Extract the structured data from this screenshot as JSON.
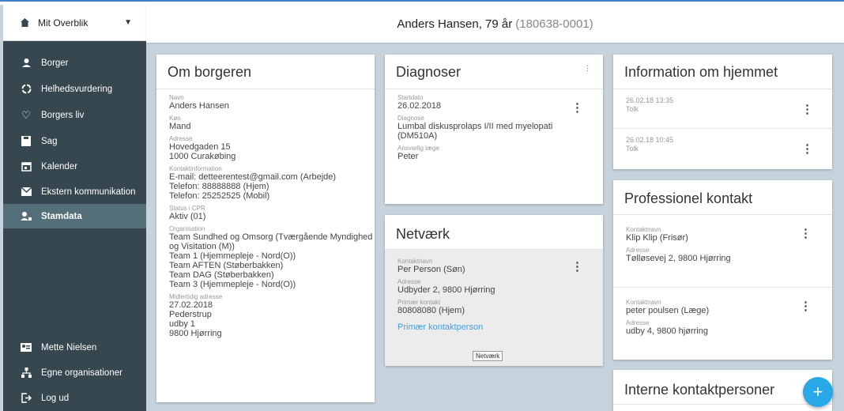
{
  "sidebar": {
    "overview_label": "Mit Overblik",
    "nav": [
      {
        "label": "Borger"
      },
      {
        "label": "Helhedsvurdering"
      },
      {
        "label": "Borgers liv"
      },
      {
        "label": "Sag"
      },
      {
        "label": "Kalender"
      },
      {
        "label": "Ekstern kommunikation"
      },
      {
        "label": "Stamdata"
      }
    ],
    "bottom": [
      {
        "label": "Mette Nielsen"
      },
      {
        "label": "Egne organisationer"
      },
      {
        "label": "Log ud"
      }
    ]
  },
  "header": {
    "name": "Anders Hansen, 79 år",
    "cpr": "(180638-0001)"
  },
  "om": {
    "title": "Om borgeren",
    "navn_label": "Navn",
    "navn": "Anders Hansen",
    "kon_label": "Køn",
    "kon": "Mand",
    "adresse_label": "Adresse",
    "adresse1": "Hovedgaden 15",
    "adresse2": "1000 Curakøbing",
    "kontakt_label": "Kontaktinformation",
    "kontakt1": "E-mail: detteerentest@gmail.com (Arbejde)",
    "kontakt2": "Telefon: 88888888 (Hjem)",
    "kontakt3": "Telefon: 25252525 (Mobil)",
    "status_label": "Status i CPR",
    "status": "Aktiv (01)",
    "org_label": "Organisation",
    "org1": "Team Sundhed og Omsorg (Tværgående Myndighed",
    "org2": "og Visitation (M))",
    "org3": "Team 1 (Hjemmepleje - Nord(O))",
    "org4": "Team AFTEN (Støberbakken)",
    "org5": "Team DAG (Støberbakken)",
    "org6": "Team 3 (Hjemmepleje - Nord(O))",
    "midl_label": "Midlertidig adresse",
    "midl1": "27.02.2018",
    "midl2": "Pederstrup",
    "midl3": "udby 1",
    "midl4": "9800 Hjørring"
  },
  "diagnoser": {
    "title": "Diagnoser",
    "start_label": "Startdato",
    "start": "26.02.2018",
    "diag_label": "Diagnose",
    "diag1": "Lumbal diskusprolaps I/II med myelopati",
    "diag2": "(DM510A)",
    "laege_label": "Ansvarlig læge",
    "laege": "Peter"
  },
  "netvaerk": {
    "title": "Netværk",
    "navn_label": "Kontaktnavn",
    "navn": "Per Person (Søn)",
    "adresse_label": "Adresse",
    "adresse": "Udbyder 2, 9800 Hjørring",
    "primaer_label": "Primær kontakt",
    "primaer": "80808080 (Hjem)",
    "link": "Primær kontaktperson",
    "tooltip": "Netværk"
  },
  "hjem": {
    "title": "Information om hjemmet",
    "rows": [
      {
        "date": "26.02.18 13:35",
        "text": "Tolk"
      },
      {
        "date": "26.02.18 10:45",
        "text": "Tolk"
      }
    ]
  },
  "prof": {
    "title": "Professionel kontakt",
    "rows": [
      {
        "navn_label": "Kontaktnavn",
        "navn": "Klip Klip (Frisør)",
        "adresse_label": "Adresse",
        "adresse": "Tølløsevej 2, 9800 Hjørring"
      },
      {
        "navn_label": "Kontaktnavn",
        "navn": "peter poulsen (Læge)",
        "adresse_label": "Adresse",
        "adresse": "udby 4, 9800 hjørring"
      }
    ]
  },
  "interne": {
    "title": "Interne kontaktpersoner"
  },
  "fab": "+",
  "colors": {
    "sidebar": "#37474f",
    "active": "#546e7a",
    "background": "#c7d3dc",
    "link": "#4a9fd8",
    "fab": "#29a8e8"
  }
}
